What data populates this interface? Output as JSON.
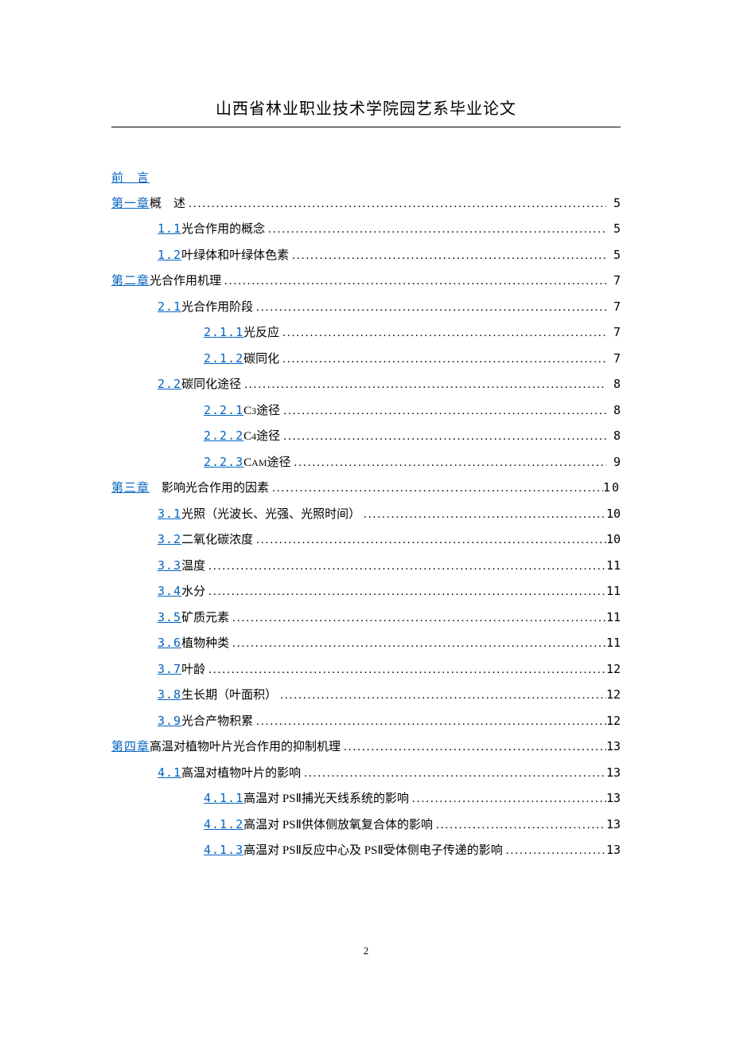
{
  "header": {
    "title": "山西省林业职业技术学院园艺系毕业论文"
  },
  "toc": {
    "entries": [
      {
        "level": 0,
        "num": "",
        "label": "前　言",
        "page": "",
        "nodots": true
      },
      {
        "level": 0,
        "num": "第一章",
        "label": "概　述",
        "page": "5"
      },
      {
        "level": 1,
        "num": "1.1",
        "label": "光合作用的概念",
        "page": "5"
      },
      {
        "level": 1,
        "num": "1.2",
        "label": "叶绿体和叶绿体色素",
        "page": "5"
      },
      {
        "level": 0,
        "num": "第二章",
        "label": "光合作用机理",
        "page": "7"
      },
      {
        "level": 1,
        "num": "2.1",
        "label": "光合作用阶段",
        "page": "7"
      },
      {
        "level": 2,
        "num": "2.1.1",
        "label": "光反应",
        "page": "7"
      },
      {
        "level": 2,
        "num": "2.1.2",
        "label": "碳同化",
        "page": "7"
      },
      {
        "level": 1,
        "num": "2.2",
        "label": "碳同化途径",
        "page": "8"
      },
      {
        "level": 2,
        "num": "2.2.1",
        "label": "C",
        "sub": "3",
        "label2": "途径",
        "page": "8"
      },
      {
        "level": 2,
        "num": "2.2.2",
        "label": "C",
        "sub": "4",
        "label2": "途径",
        "page": "8"
      },
      {
        "level": 2,
        "num": "2.2.3",
        "label": "C",
        "sub": "AM",
        "label2": "途径",
        "page": "9"
      },
      {
        "level": 0,
        "num": "第三章",
        "label": "　影响光合作用的因素",
        "page": " 10",
        "wide": true
      },
      {
        "level": 1,
        "num": "3.1",
        "label": "光照（光波长、光强、光照时间）",
        "page": "10"
      },
      {
        "level": 1,
        "num": "3.2",
        "label": "二氧化碳浓度",
        "page": "10"
      },
      {
        "level": 1,
        "num": "3.3",
        "label": "温度",
        "page": "11"
      },
      {
        "level": 1,
        "num": "3.4",
        "label": "水分",
        "page": "11"
      },
      {
        "level": 1,
        "num": "3.5",
        "label": "矿质元素",
        "page": "11"
      },
      {
        "level": 1,
        "num": "3.6",
        "label": "植物种类",
        "page": "11"
      },
      {
        "level": 1,
        "num": "3.7",
        "label": "叶龄",
        "page": "12"
      },
      {
        "level": 1,
        "num": "3.8",
        "label": "生长期（叶面积）",
        "page": "12"
      },
      {
        "level": 1,
        "num": "3.9",
        "label": "光合产物积累",
        "page": "12"
      },
      {
        "level": 0,
        "num": "第四章",
        "label": "高温对植物叶片光合作用的抑制机理",
        "page": "13"
      },
      {
        "level": 1,
        "num": "4.1",
        "label": "高温对植物叶片的影响",
        "page": "13"
      },
      {
        "level": 2,
        "num": "4.1.1",
        "label": "高温对 PSⅡ捕光天线系统的影响",
        "page": "13"
      },
      {
        "level": 2,
        "num": "4.1.2",
        "label": "高温对 PSⅡ供体侧放氧复合体的影响",
        "page": "13"
      },
      {
        "level": 2,
        "num": "4.1.3",
        "label": "高温对 PSⅡ反应中心及 PSⅡ受体侧电子传递的影响",
        "page": "13"
      }
    ]
  },
  "footer": {
    "page_number": "2"
  }
}
